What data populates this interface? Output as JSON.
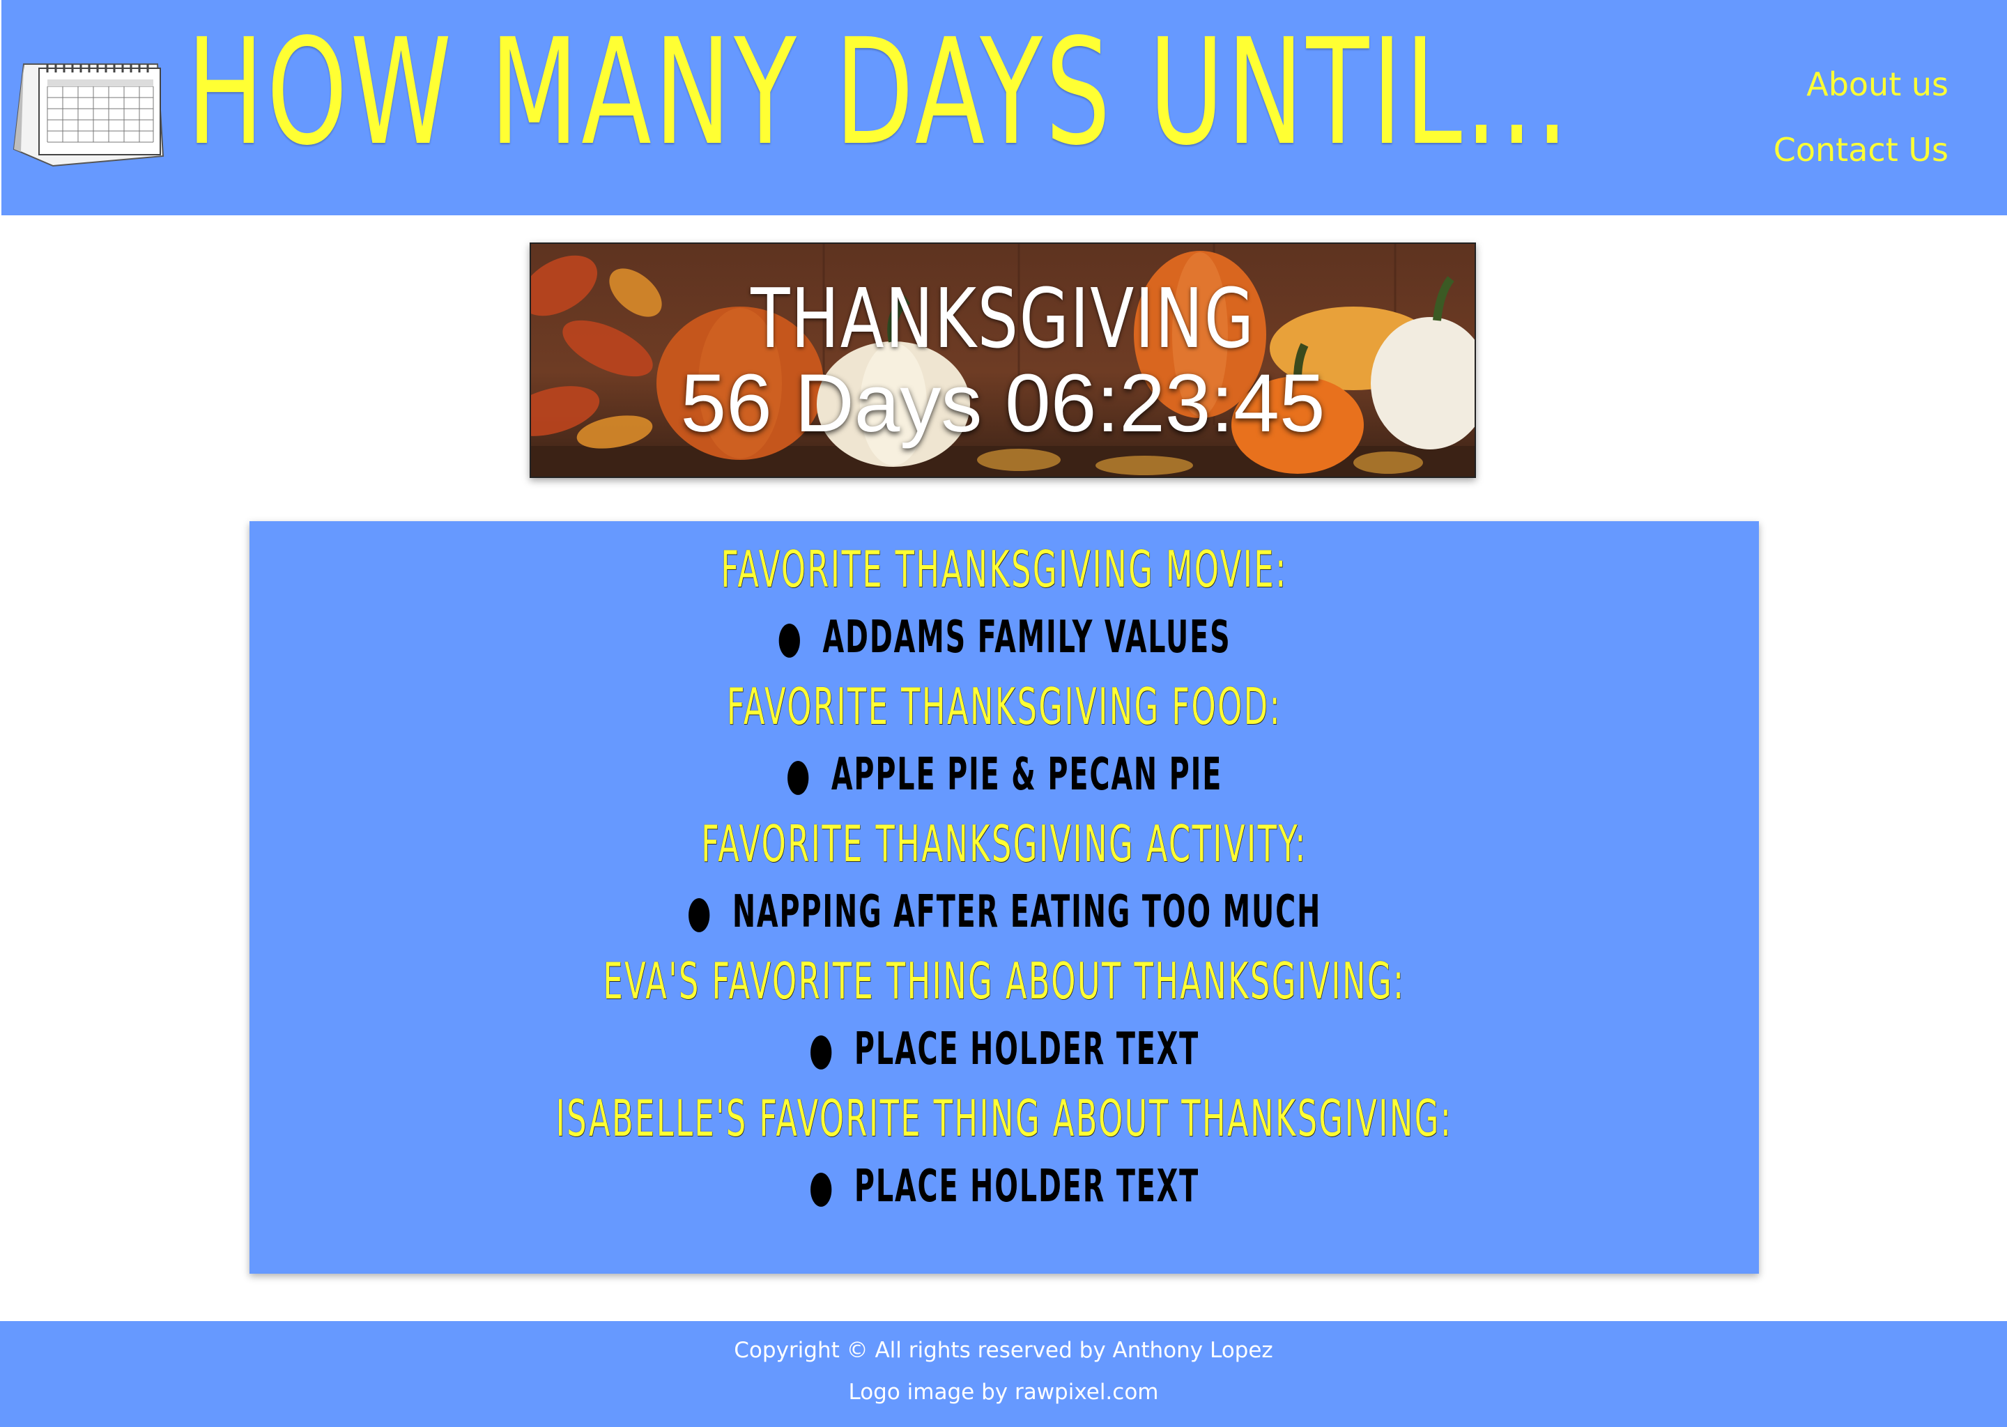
{
  "header": {
    "title": "HOW MANY DAYS UNTIL...",
    "logo_icon": "calendar-icon",
    "nav": [
      {
        "label": "About us"
      },
      {
        "label": "Contact Us"
      }
    ]
  },
  "countdown": {
    "holiday": "THANKSGIVING",
    "remaining": "56 Days 06:23:45"
  },
  "favorites": [
    {
      "heading": "Favorite Thanksgiving Movie:",
      "answer": "Addams Family Values"
    },
    {
      "heading": "Favorite Thanksgiving Food:",
      "answer": "Apple Pie & Pecan Pie"
    },
    {
      "heading": "Favorite Thanksgiving Activity:",
      "answer": "Napping after eating too much"
    },
    {
      "heading": "Eva's Favorite thing about Thanksgiving:",
      "answer": "Place holder text"
    },
    {
      "heading": "Isabelle's Favorite thing about Thanksgiving:",
      "answer": "Place holder text"
    }
  ],
  "footer": {
    "copyright": "Copyright © All rights reserved by Anthony Lopez",
    "credit": "Logo image by rawpixel.com"
  },
  "colors": {
    "brand_blue": "#6699ff",
    "accent_yellow": "#ffff33"
  }
}
